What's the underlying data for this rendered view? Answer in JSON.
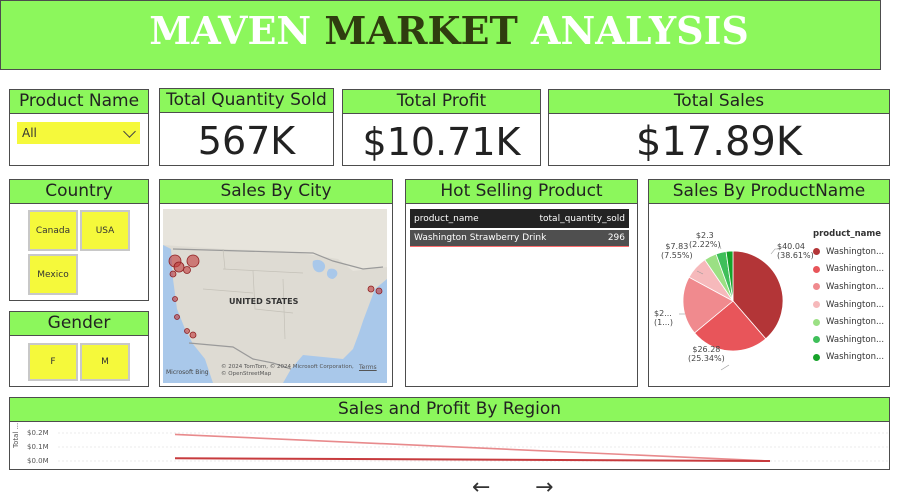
{
  "banner": {
    "title_w1": "MAVEN",
    "title_w2": "MARKET",
    "title_w3": "ANALYSIS"
  },
  "slicer_product": {
    "title": "Product Name",
    "selected": "All"
  },
  "kpis": {
    "quantity": {
      "title": "Total Quantity Sold",
      "value": "567K"
    },
    "profit": {
      "title": "Total Profit",
      "value": "$10.71K"
    },
    "sales": {
      "title": "Total Sales",
      "value": "$17.89K"
    }
  },
  "slicer_country": {
    "title": "Country",
    "options": [
      "Canada",
      "USA",
      "Mexico"
    ]
  },
  "slicer_gender": {
    "title": "Gender",
    "options": [
      "F",
      "M"
    ]
  },
  "city_map": {
    "title": "Sales By City",
    "country_label": "UNITED STATES",
    "attribution": "© 2024 TomTom, © 2024 Microsoft Corporation, © OpenStreetMap",
    "terms": "Terms",
    "bing": "Microsoft Bing"
  },
  "hot_selling": {
    "title": "Hot Selling Product",
    "columns": [
      "product_name",
      "total_quantity_sold"
    ],
    "rows": [
      [
        "Washington Strawberry Drink",
        "296"
      ]
    ]
  },
  "sales_by_product": {
    "title": "Sales By ProductName",
    "legend_title": "product_name",
    "legend_items": [
      "Washington...",
      "Washington...",
      "Washington...",
      "Washington...",
      "Washington...",
      "Washington...",
      "Washington..."
    ],
    "colors": [
      "#b33537",
      "#e8555a",
      "#f08a8e",
      "#f6b9bb",
      "#9be084",
      "#3fbf5a",
      "#17a32a"
    ],
    "labels": {
      "a": {
        "value": "$40.04",
        "pct": "(38.61%)"
      },
      "b": {
        "value": "$26.28",
        "pct": "(25.34%)"
      },
      "c": {
        "value": "$2...",
        "pct": "(1...)"
      },
      "d": {
        "value": "$7.83",
        "pct": "(7.55%)"
      },
      "e": {
        "value": "$2.3",
        "pct": "(2.22%)"
      }
    }
  },
  "region_chart": {
    "title": "Sales and Profit By Region",
    "ylabel": "Total ...",
    "ticks": [
      "$0.2M",
      "$0.1M",
      "$0.0M"
    ]
  },
  "chart_data": [
    {
      "type": "pie",
      "title": "Sales By ProductName",
      "categories": [
        "Washington...",
        "Washington...",
        "Washington...",
        "Washington...",
        "Washington...",
        "Washington...",
        "Washington..."
      ],
      "values": [
        40.04,
        26.28,
        19.6,
        7.83,
        4.2,
        3.4,
        2.3
      ],
      "percent_labels": [
        "38.61%",
        "25.34%",
        "",
        "7.55%",
        "",
        "",
        "2.22%"
      ]
    },
    {
      "type": "line",
      "title": "Sales and Profit By Region",
      "ylabel": "Total ...",
      "ylim": [
        0,
        0.2
      ],
      "yticks": [
        "$0.2M",
        "$0.1M",
        "$0.0M"
      ],
      "series": [
        {
          "values": [
            0.19,
            0.0
          ]
        },
        {
          "values": [
            0.02,
            0.0
          ]
        }
      ]
    }
  ],
  "nav": {
    "prev": "←",
    "next": "→"
  }
}
